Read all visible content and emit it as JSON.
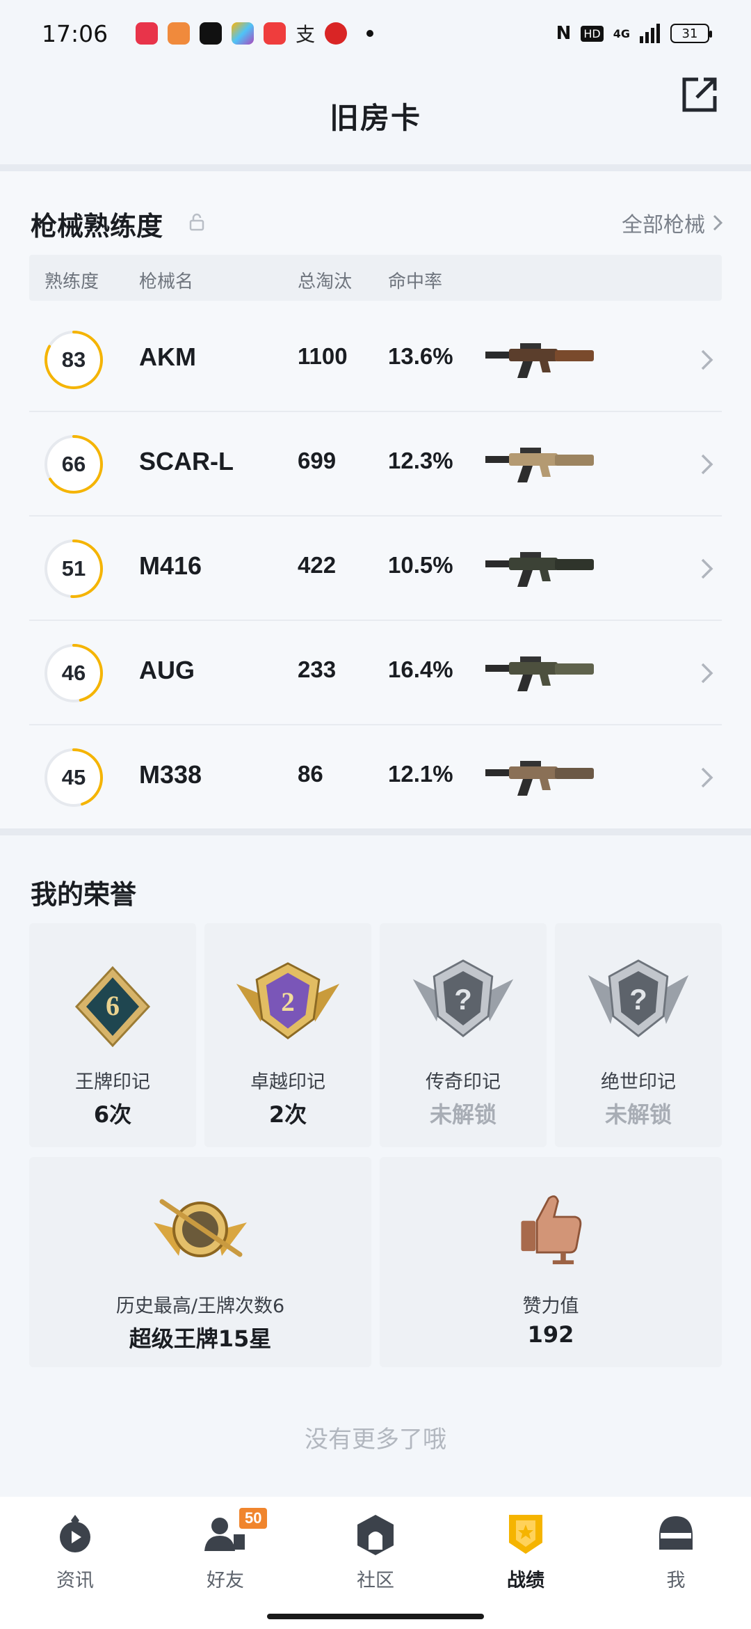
{
  "status_bar": {
    "time": "17:06",
    "network": "4G",
    "battery": "31"
  },
  "header": {
    "title": "旧房卡"
  },
  "weapons": {
    "title": "枪械熟练度",
    "all_link": "全部枪械",
    "columns": [
      "熟练度",
      "枪械名",
      "总淘汰",
      "命中率"
    ],
    "rows": [
      {
        "proficiency": "83",
        "proficiency_fraction": 0.83,
        "name": "AKM",
        "kills": "1100",
        "accuracy": "13.6%",
        "icon": "akm-rifle-icon"
      },
      {
        "proficiency": "66",
        "proficiency_fraction": 0.66,
        "name": "SCAR-L",
        "kills": "699",
        "accuracy": "12.3%",
        "icon": "scar-rifle-icon"
      },
      {
        "proficiency": "51",
        "proficiency_fraction": 0.51,
        "name": "M416",
        "kills": "422",
        "accuracy": "10.5%",
        "icon": "m416-rifle-icon"
      },
      {
        "proficiency": "46",
        "proficiency_fraction": 0.46,
        "name": "AUG",
        "kills": "233",
        "accuracy": "16.4%",
        "icon": "aug-rifle-icon"
      },
      {
        "proficiency": "45",
        "proficiency_fraction": 0.45,
        "name": "M338",
        "kills": "86",
        "accuracy": "12.1%",
        "icon": "m338-gun-icon"
      }
    ]
  },
  "honors": {
    "title": "我的荣誉",
    "badges": [
      {
        "label": "王牌印记",
        "value": "6次",
        "badge_text": "6",
        "locked": false
      },
      {
        "label": "卓越印记",
        "value": "2次",
        "badge_text": "2",
        "locked": false
      },
      {
        "label": "传奇印记",
        "value": "未解锁",
        "badge_text": "?",
        "locked": true
      },
      {
        "label": "绝世印记",
        "value": "未解锁",
        "badge_text": "?",
        "locked": true
      }
    ],
    "wide": [
      {
        "label": "历史最高/王牌次数6",
        "value": "超级王牌15星"
      },
      {
        "label": "赞力值",
        "value": "192"
      }
    ]
  },
  "footer_text": "没有更多了哦",
  "nav": {
    "items": [
      {
        "label": "资讯",
        "icon": "news-icon"
      },
      {
        "label": "好友",
        "icon": "friends-icon",
        "badge": "50"
      },
      {
        "label": "社区",
        "icon": "community-icon"
      },
      {
        "label": "战绩",
        "icon": "record-icon",
        "active": true
      },
      {
        "label": "我",
        "icon": "profile-helmet-icon"
      }
    ]
  },
  "colors": {
    "accent": "#f5b400",
    "ring_track": "#e6e9ee",
    "badge_orange": "#f0852d"
  }
}
